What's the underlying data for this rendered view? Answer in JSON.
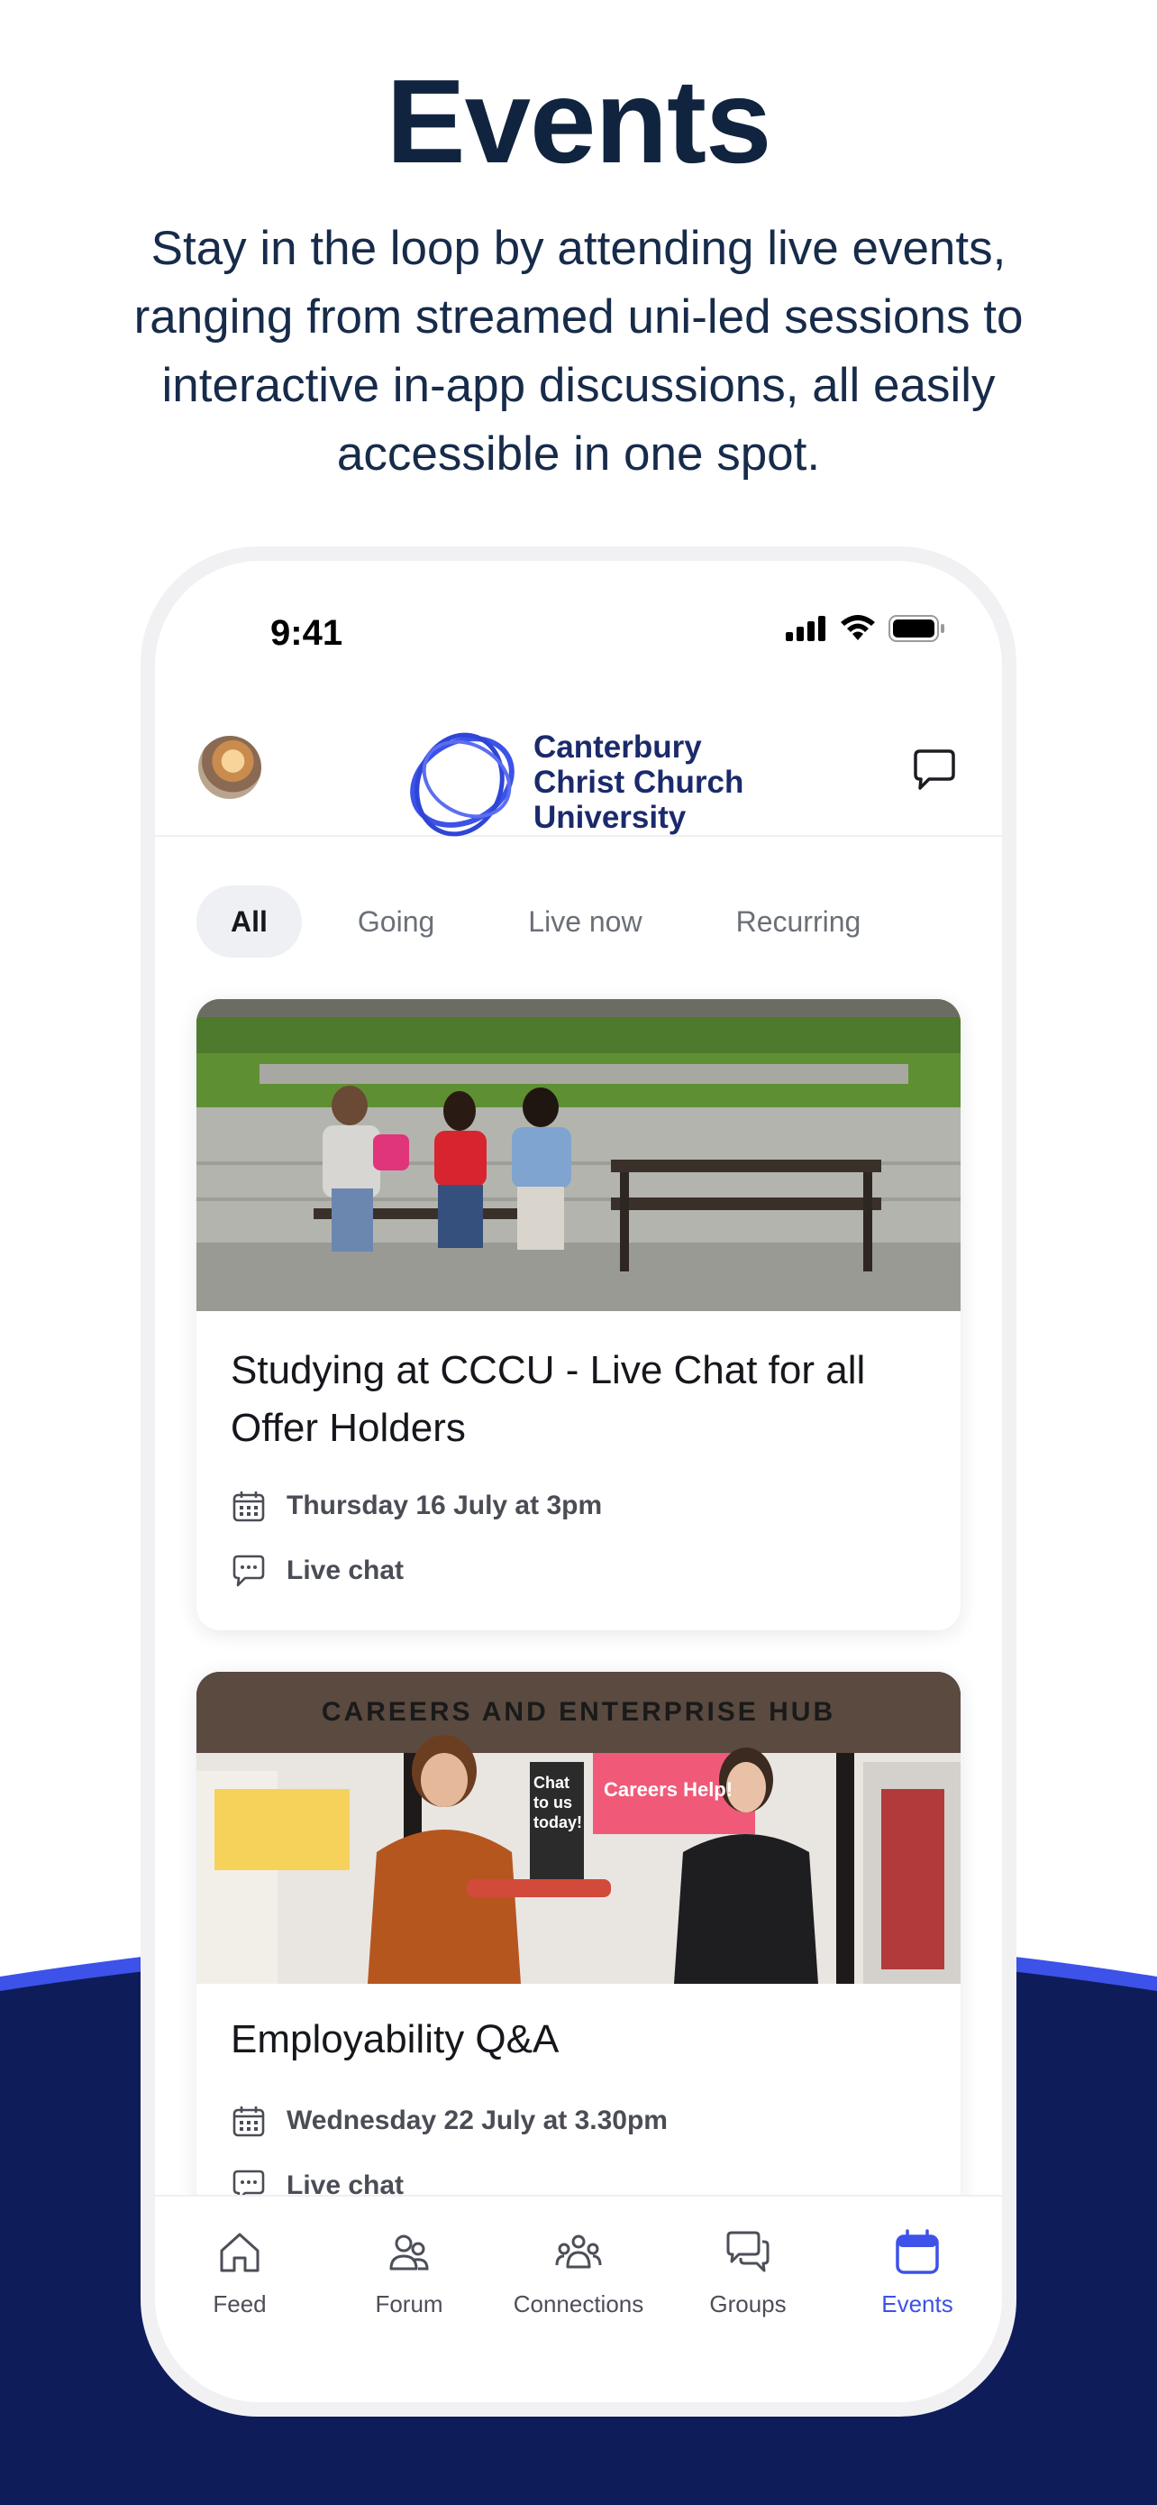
{
  "headline": "Events",
  "subtitle": "Stay in the loop by attending live events, ranging from streamed uni-led sessions to interactive in-app discussions, all easily accessible in one spot.",
  "status_bar": {
    "time": "9:41"
  },
  "app_header": {
    "logo_lines": [
      "Canterbury",
      "Christ Church",
      "University"
    ]
  },
  "tabs": [
    {
      "label": "All",
      "active": true
    },
    {
      "label": "Going",
      "active": false
    },
    {
      "label": "Live now",
      "active": false
    },
    {
      "label": "Recurring",
      "active": false
    }
  ],
  "events": [
    {
      "title": "Studying at CCCU - Live Chat for all Offer Holders",
      "date": "Thursday 16 July at 3pm",
      "type": "Live chat"
    },
    {
      "title": "Employability Q&A",
      "date": "Wednesday 22 July at 3.30pm",
      "type": "Live chat",
      "photo_signage": "CAREERS AND ENTERPRISE HUB",
      "photo_board": "Chat to us today!",
      "photo_screen": "Careers Help!"
    }
  ],
  "bottom_nav": [
    {
      "label": "Feed",
      "icon": "home-icon",
      "active": false
    },
    {
      "label": "Forum",
      "icon": "people-icon",
      "active": false
    },
    {
      "label": "Connections",
      "icon": "connections-icon",
      "active": false
    },
    {
      "label": "Groups",
      "icon": "groups-chat-icon",
      "active": false
    },
    {
      "label": "Events",
      "icon": "calendar-icon",
      "active": true
    }
  ],
  "colors": {
    "navy": "#0e1c5a",
    "accent_blue": "#3c52e8",
    "headline": "#10243f"
  }
}
